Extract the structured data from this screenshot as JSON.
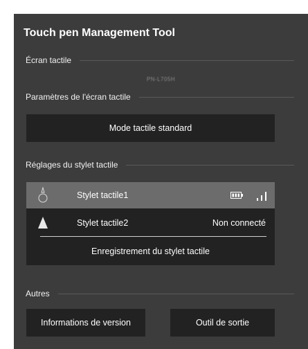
{
  "app": {
    "title": "Touch pen Management Tool"
  },
  "screen_section": {
    "label": "Écran tactile",
    "device_name": "PN-L705H"
  },
  "params_section": {
    "label": "Paramètres de l'écran tactile",
    "mode_button": "Mode tactile standard"
  },
  "stylus_section": {
    "label": "Réglages du stylet tactile",
    "items": [
      {
        "name": "Stylet tactile1",
        "status": "",
        "selected": true,
        "icons": [
          "battery-icon",
          "signal-icon"
        ]
      },
      {
        "name": "Stylet tactile2",
        "status": "Non connecté",
        "selected": false,
        "icons": []
      }
    ],
    "register_button": "Enregistrement du stylet tactile"
  },
  "other_section": {
    "label": "Autres",
    "version_button": "Informations de version",
    "exit_button": "Outil de sortie"
  },
  "colors": {
    "panel_bg": "#3c3c3c",
    "button_bg": "#222222",
    "selected_row_bg": "#6c6c6c"
  }
}
